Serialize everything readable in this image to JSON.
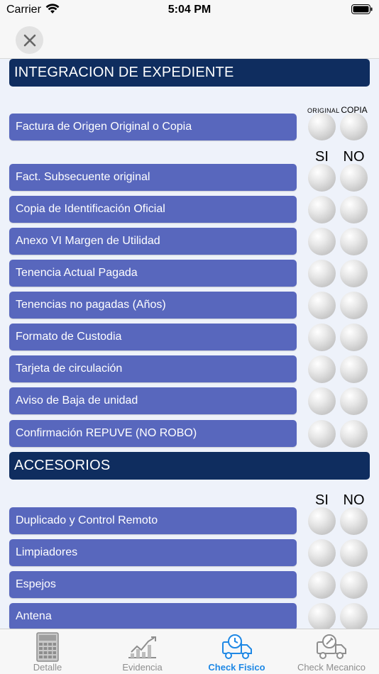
{
  "status": {
    "carrier": "Carrier",
    "time": "5:04 PM"
  },
  "sections": {
    "expediente": {
      "title": "INTEGRACION DE EXPEDIENTE"
    },
    "accesorios": {
      "title": "ACCESORIOS"
    }
  },
  "columns": {
    "original": "ORIGINAL",
    "copia": "COPIA",
    "si": "SI",
    "no": "NO"
  },
  "expediente_items": [
    "Factura de Origen Original o Copia",
    "Fact. Subsecuente original",
    "Copia de Identificación Oficial",
    "Anexo VI Margen de Utilidad",
    "Tenencia Actual Pagada",
    "Tenencias no pagadas (Años)",
    "Formato de Custodia",
    "Tarjeta de circulación",
    "Aviso de Baja de unidad",
    "Confirmación REPUVE (NO ROBO)"
  ],
  "accesorios_items": [
    "Duplicado y Control Remoto",
    "Limpiadores",
    "Espejos",
    "Antena"
  ],
  "tabs": [
    {
      "label": "Detalle",
      "icon": "calculator-icon"
    },
    {
      "label": "Evidencia",
      "icon": "chart-icon"
    },
    {
      "label": "Check Fisico",
      "icon": "truck-check-icon",
      "active": true
    },
    {
      "label": "Check  Mecanico",
      "icon": "truck-wrench-icon"
    }
  ],
  "colors": {
    "header": "#0f2d5f",
    "row": "#5867bd",
    "active_tab": "#1e88e5",
    "background": "#eef2fa"
  }
}
